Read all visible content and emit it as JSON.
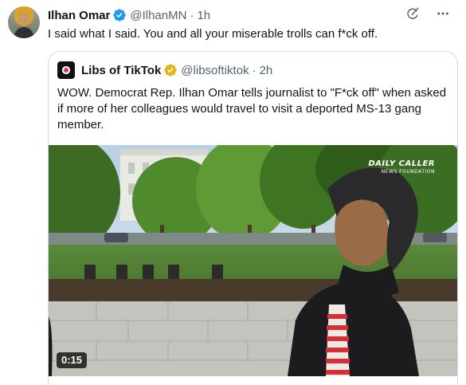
{
  "tweet": {
    "author_name": "Ilhan Omar",
    "author_handle": "@IlhanMN",
    "separator": "·",
    "time": "1h",
    "text": "I said what I said. You and all your miserable trolls can f*ck off."
  },
  "quote": {
    "author_name": "Libs of TikTok",
    "author_handle": "@libsoftiktok",
    "separator": "·",
    "time": "2h",
    "text": "WOW. Democrat Rep. Ilhan Omar tells journalist to \"F*ck off\" when asked if more of her colleagues would travel to visit a deported MS-13 gang member."
  },
  "media": {
    "duration": "0:15",
    "watermark_line1": "DAILY CALLER",
    "watermark_line2": "NEWS FOUNDATION"
  },
  "icons": {
    "verified": "verified-badge-icon",
    "grok": "grok-icon",
    "more": "more-icon"
  },
  "colors": {
    "verified_blue": "#1d9bf0",
    "verified_gold": "#e2b719",
    "secondary_text": "#536471",
    "border": "#cfd9de"
  }
}
